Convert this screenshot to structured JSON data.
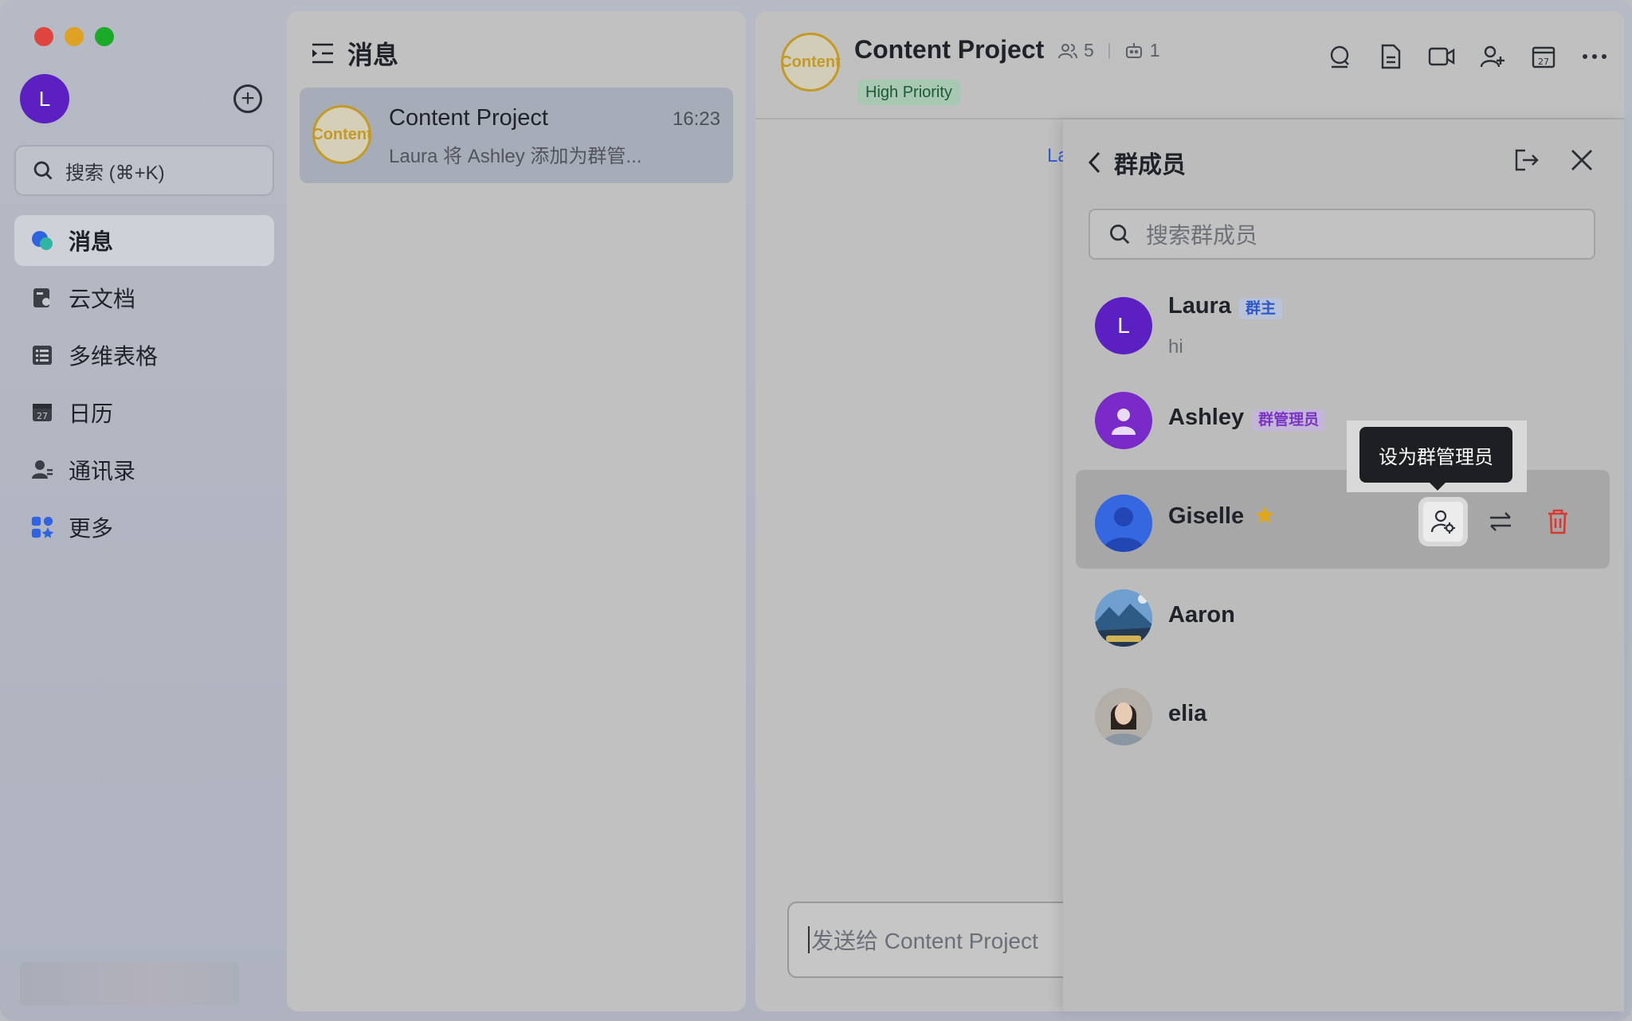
{
  "window": {
    "traffic_lights": [
      "close",
      "minimize",
      "zoom"
    ],
    "colors": {
      "red": "#e0443e",
      "yellow": "#dea123",
      "green": "#1aab29"
    }
  },
  "nav": {
    "avatar_initial": "L",
    "avatar_color": "#5b1fc2",
    "search_placeholder": "搜索 (⌘+K)",
    "items": [
      {
        "label": "消息",
        "icon": "chat-bubbles-icon",
        "active": true
      },
      {
        "label": "云文档",
        "icon": "document-icon",
        "active": false
      },
      {
        "label": "多维表格",
        "icon": "table-icon",
        "active": false
      },
      {
        "label": "日历",
        "icon": "calendar-icon",
        "active": false
      },
      {
        "label": "通讯录",
        "icon": "contacts-icon",
        "active": false
      },
      {
        "label": "更多",
        "icon": "apps-grid-icon",
        "active": false
      }
    ]
  },
  "conversations": {
    "header": "消息",
    "items": [
      {
        "avatar_text": "Cont ent",
        "title": "Content Project",
        "time": "16:23",
        "preview": "Laura 将 Ashley 添加为群管..."
      }
    ]
  },
  "chat": {
    "avatar_text": "Cont ent",
    "title": "Content Project",
    "member_count": "5",
    "bot_count": "1",
    "tag": "High Priority",
    "system_peek": "La",
    "composer_placeholder": "发送给 Content Project",
    "tools": [
      "search-chat-icon",
      "doc-icon",
      "video-call-icon",
      "add-member-icon",
      "calendar-icon",
      "more-icon"
    ]
  },
  "members": {
    "title": "群成员",
    "search_placeholder": "搜索群成员",
    "list": [
      {
        "name": "Laura",
        "badge": "群主",
        "badge_type": "owner",
        "status": "hi",
        "avatar_initial": "L",
        "avatar_color": "#5b1fc2"
      },
      {
        "name": "Ashley",
        "badge": "群管理员",
        "badge_type": "admin",
        "status": "",
        "avatar_initial": "",
        "avatar_color": "#7a2ac8"
      },
      {
        "name": "Giselle",
        "badge": "",
        "badge_type": "",
        "status": "",
        "avatar_initial": "",
        "avatar_color": "#2c5bd6",
        "starred": true
      },
      {
        "name": "Aaron",
        "badge": "",
        "badge_type": "",
        "status": "",
        "avatar_initial": "",
        "avatar_color": "#3c6e9e"
      },
      {
        "name": "elia",
        "badge": "",
        "badge_type": "",
        "status": "",
        "avatar_initial": "",
        "avatar_color": "#9a9188"
      }
    ],
    "tooltip": "设为群管理员"
  }
}
